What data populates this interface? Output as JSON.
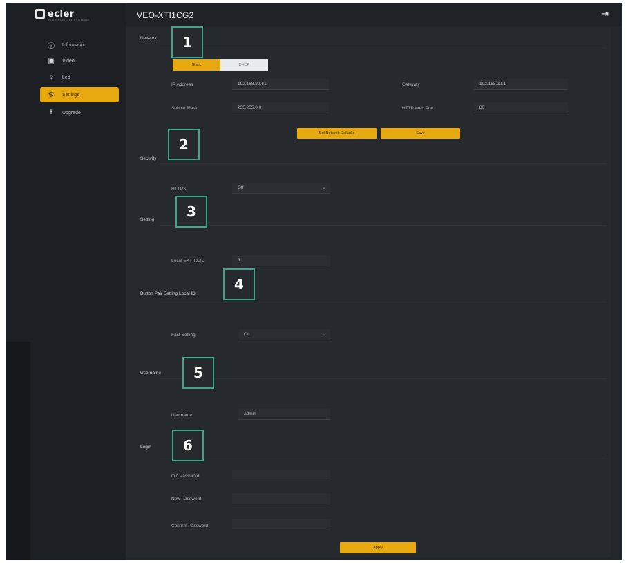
{
  "app": {
    "logo_text": "ecler",
    "logo_subtext": "HIGH FIDELITY SYSTEMS",
    "device_title": "VEO-XTI1CG2"
  },
  "sidebar": {
    "items": [
      {
        "label": "Information",
        "icon": "info-icon"
      },
      {
        "label": "Video",
        "icon": "video-icon"
      },
      {
        "label": "Led",
        "icon": "led-icon"
      },
      {
        "label": "Settings",
        "icon": "gear-icon",
        "active": true
      },
      {
        "label": "Upgrade",
        "icon": "upload-icon"
      }
    ]
  },
  "network": {
    "title": "Network",
    "mode_options": [
      "Static",
      "DHCP"
    ],
    "mode_selected": "Static",
    "ip_label": "IP Address",
    "ip_value": "192.168.22.61",
    "gateway_label": "Gateway",
    "gateway_value": "192.168.22.1",
    "subnet_label": "Subnet Mask",
    "subnet_value": "255.255.0.0",
    "http_port_label": "HTTP Web Port",
    "http_port_value": "80",
    "defaults_button": "Set Network Defaults",
    "save_button": "Save"
  },
  "security": {
    "title": "Security",
    "https_label": "HTTPS",
    "https_value": "Off"
  },
  "setting": {
    "title": "Setting",
    "local_id_label": "Local EXT-TX/ID",
    "local_id_value": "3"
  },
  "button_pair": {
    "title": "Button Pair Setting Local ID",
    "fast_label": "Fast Setting",
    "fast_value": "On"
  },
  "username": {
    "title": "Username",
    "label": "Username",
    "value": "admin"
  },
  "login": {
    "title": "Login",
    "old_password_label": "Old Password",
    "new_password_label": "New Password",
    "confirm_password_label": "Confirm Password",
    "apply_button": "Apply"
  },
  "callouts": [
    "1",
    "2",
    "3",
    "4",
    "5",
    "6"
  ],
  "colors": {
    "accent": "#e7a910",
    "callout_border": "#3fa58c",
    "background": "#23272c"
  }
}
